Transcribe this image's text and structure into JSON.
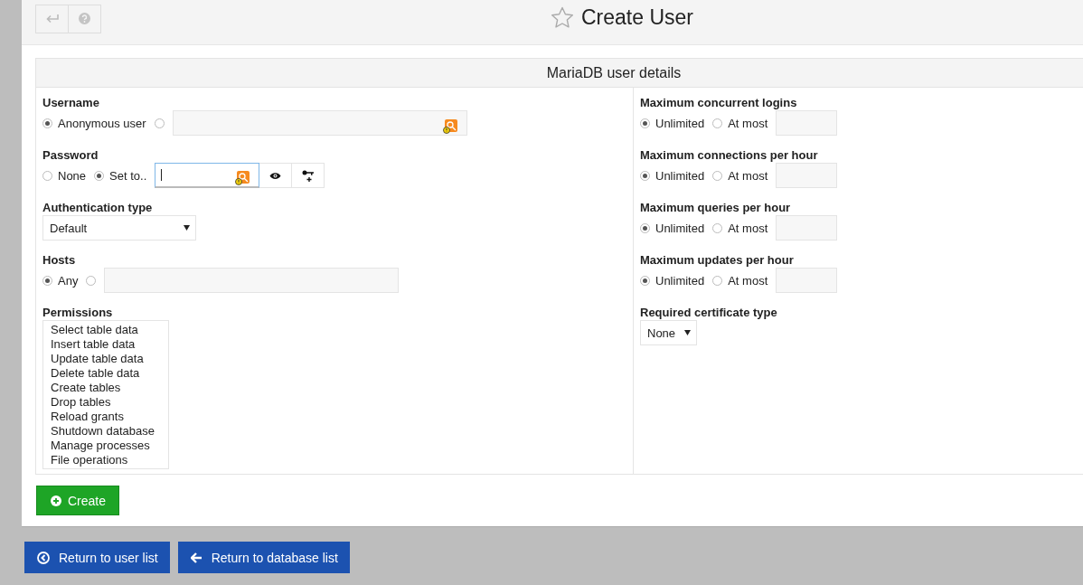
{
  "header": {
    "title": "Create User"
  },
  "panel": {
    "title": "MariaDB user details",
    "left": [
      {
        "kind": "radio_field",
        "label": "Username",
        "options": [
          {
            "label": "Anonymous user",
            "selected": true
          },
          {
            "selected": false
          }
        ],
        "autofill_icon": true
      },
      {
        "kind": "password",
        "label": "Password",
        "options": [
          {
            "label": "None",
            "selected": false
          },
          {
            "label": "Set to..",
            "selected": true
          }
        ],
        "focused": true,
        "autofill_icon": true
      },
      {
        "kind": "select",
        "label": "Authentication type",
        "value": "Default"
      },
      {
        "kind": "radio_field",
        "label": "Hosts",
        "options": [
          {
            "label": "Any",
            "selected": true
          },
          {
            "selected": false
          }
        ],
        "autofill_icon": false
      },
      {
        "kind": "list",
        "label": "Permissions",
        "items": [
          "Select table data",
          "Insert table data",
          "Update table data",
          "Delete table data",
          "Create tables",
          "Drop tables",
          "Reload grants",
          "Shutdown database",
          "Manage processes",
          "File operations"
        ]
      }
    ],
    "right": [
      {
        "kind": "radio_field",
        "label": "Maximum concurrent logins",
        "options": [
          {
            "label": "Unlimited",
            "selected": true
          },
          {
            "label": "At most",
            "selected": false
          }
        ],
        "autofill_icon": false
      },
      {
        "kind": "radio_field",
        "label": "Maximum connections per hour",
        "options": [
          {
            "label": "Unlimited",
            "selected": true
          },
          {
            "label": "At most",
            "selected": false
          }
        ],
        "autofill_icon": false
      },
      {
        "kind": "radio_field",
        "label": "Maximum queries per hour",
        "options": [
          {
            "label": "Unlimited",
            "selected": true
          },
          {
            "label": "At most",
            "selected": false
          }
        ],
        "autofill_icon": false
      },
      {
        "kind": "radio_field",
        "label": "Maximum updates per hour",
        "options": [
          {
            "label": "Unlimited",
            "selected": true
          },
          {
            "label": "At most",
            "selected": false
          }
        ],
        "autofill_icon": false
      },
      {
        "kind": "select",
        "label": "Required certificate type",
        "value": "None"
      }
    ]
  },
  "create_button": "Create",
  "footer_buttons": [
    {
      "kind": "back_circle",
      "label": "Return to user list"
    },
    {
      "kind": "arrow",
      "label": "Return to database list"
    }
  ]
}
